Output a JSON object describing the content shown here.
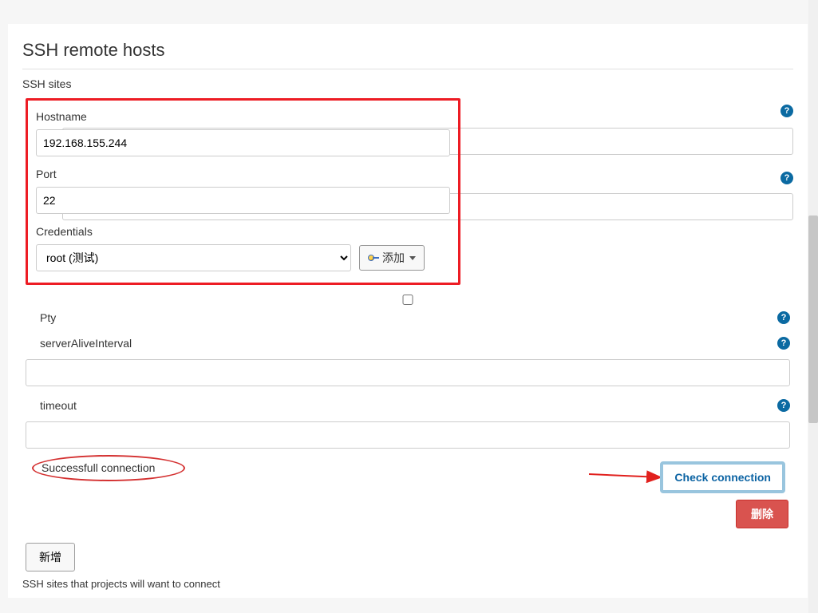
{
  "header": {
    "title": "SSH remote hosts"
  },
  "subtitle": "SSH sites",
  "fields": {
    "hostname": {
      "label": "Hostname",
      "value": "192.168.155.244"
    },
    "port": {
      "label": "Port",
      "value": "22"
    },
    "credentials": {
      "label": "Credentials",
      "selected": "root (测试)",
      "add_label": "添加"
    },
    "pty": {
      "label": "Pty"
    },
    "serverAliveInterval": {
      "label": "serverAliveInterval",
      "value": ""
    },
    "timeout": {
      "label": "timeout",
      "value": ""
    }
  },
  "status": {
    "message": "Successfull connection"
  },
  "buttons": {
    "check": "Check connection",
    "delete": "删除",
    "add": "新增"
  },
  "footer": {
    "note": "SSH sites that projects will want to connect"
  },
  "help_glyph": "?"
}
